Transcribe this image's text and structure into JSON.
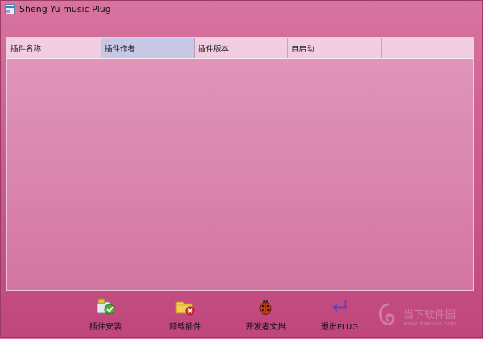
{
  "window": {
    "title": "Sheng Yu music Plug",
    "title_icon": "app-icon"
  },
  "list": {
    "columns": [
      "插件名称",
      "插件作者",
      "插件版本",
      "自启动",
      ""
    ],
    "rows": []
  },
  "toolbar": {
    "install_label": "插件安装",
    "uninstall_label": "卸载插件",
    "developer_docs_label": "开发者文档",
    "exit_label": "退出PLUG"
  },
  "watermark": {
    "text": "当下软件园",
    "subtext": "www.downxia.com"
  },
  "colors": {
    "background": "#cc5e8f",
    "header_selected": "#c8c8e6",
    "exit_arrow": "#6a3fb0"
  }
}
